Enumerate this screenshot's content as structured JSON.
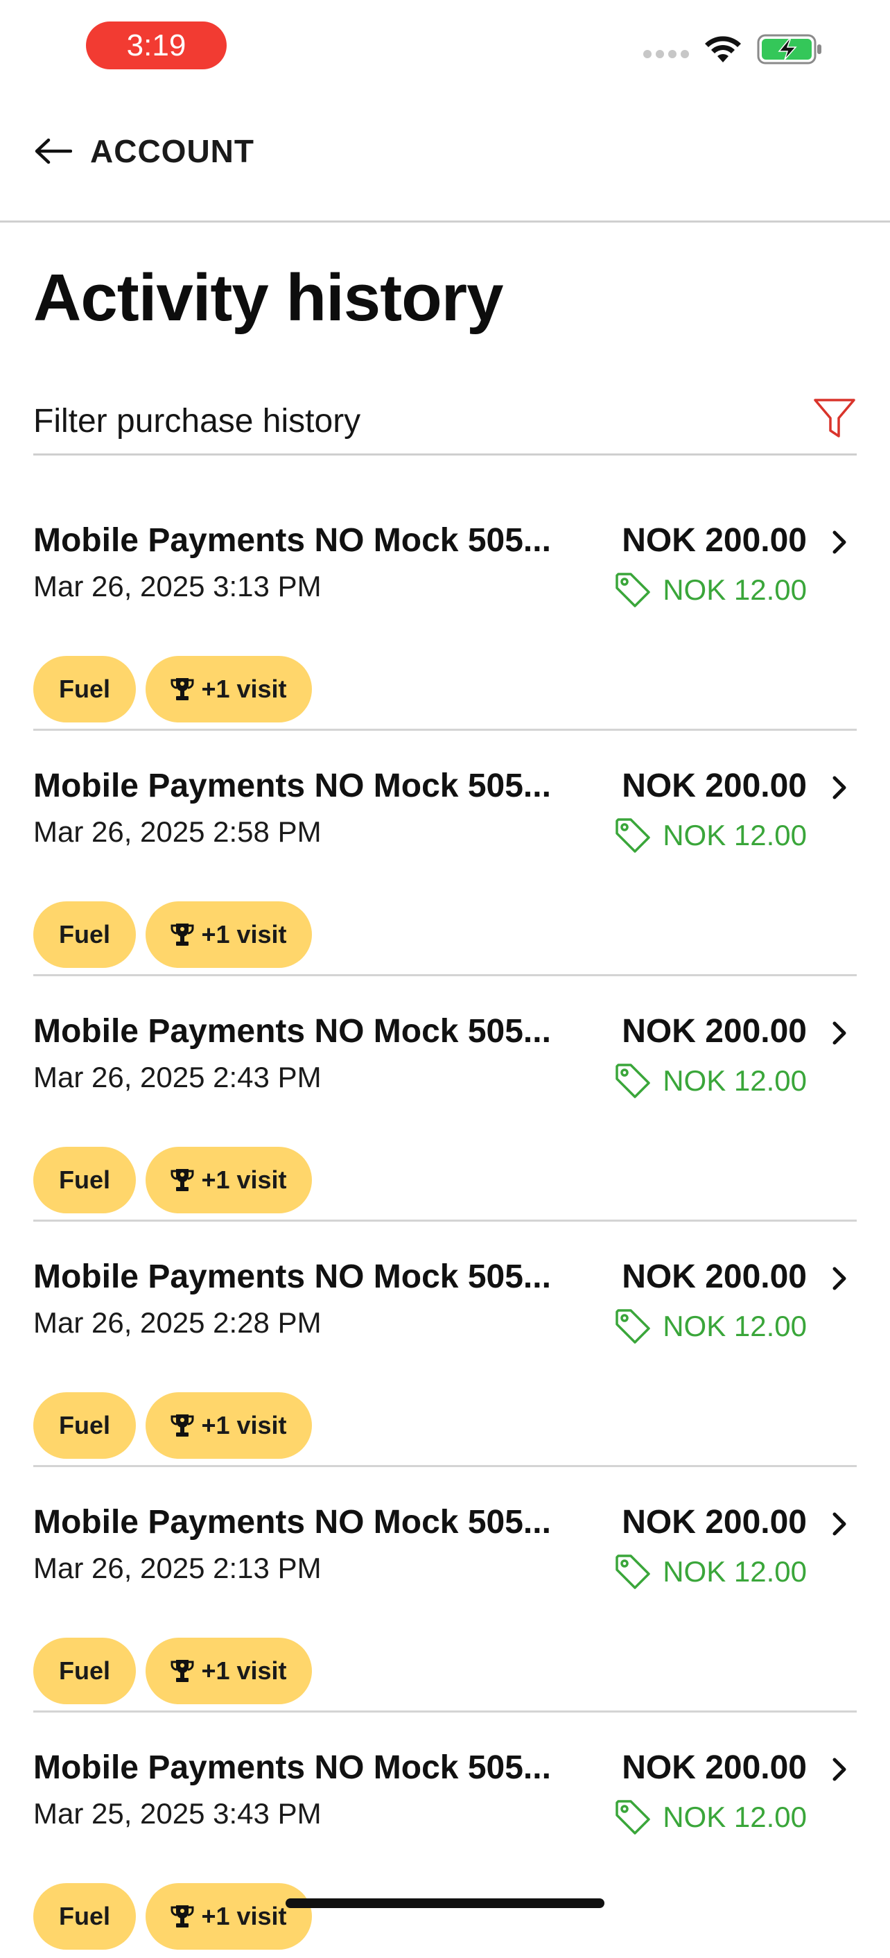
{
  "status_bar": {
    "time": "3:19"
  },
  "nav": {
    "back_label": "ACCOUNT"
  },
  "page": {
    "title": "Activity history"
  },
  "filter": {
    "label": "Filter purchase history"
  },
  "activities": [
    {
      "merchant": "Mobile Payments NO Mock 505...",
      "date": "Mar 26, 2025 3:13 PM",
      "amount": "NOK 200.00",
      "discount": "NOK 12.00",
      "badge_fuel": "Fuel",
      "badge_visit": "+1 visit"
    },
    {
      "merchant": "Mobile Payments NO Mock 505...",
      "date": "Mar 26, 2025 2:58 PM",
      "amount": "NOK 200.00",
      "discount": "NOK 12.00",
      "badge_fuel": "Fuel",
      "badge_visit": "+1 visit"
    },
    {
      "merchant": "Mobile Payments NO Mock 505...",
      "date": "Mar 26, 2025 2:43 PM",
      "amount": "NOK 200.00",
      "discount": "NOK 12.00",
      "badge_fuel": "Fuel",
      "badge_visit": "+1 visit"
    },
    {
      "merchant": "Mobile Payments NO Mock 505...",
      "date": "Mar 26, 2025 2:28 PM",
      "amount": "NOK 200.00",
      "discount": "NOK 12.00",
      "badge_fuel": "Fuel",
      "badge_visit": "+1 visit"
    },
    {
      "merchant": "Mobile Payments NO Mock 505...",
      "date": "Mar 26, 2025 2:13 PM",
      "amount": "NOK 200.00",
      "discount": "NOK 12.00",
      "badge_fuel": "Fuel",
      "badge_visit": "+1 visit"
    },
    {
      "merchant": "Mobile Payments NO Mock 505...",
      "date": "Mar 25, 2025 3:43 PM",
      "amount": "NOK 200.00",
      "discount": "NOK 12.00",
      "badge_fuel": "Fuel",
      "badge_visit": "+1 visit"
    }
  ],
  "colors": {
    "time_pill": "#f23b32",
    "badge": "#ffd66b",
    "discount_green": "#3aa63a",
    "filter_icon_red": "#d9342b",
    "battery_green": "#34c759"
  },
  "icons": {
    "back": "arrow-left-icon",
    "filter": "funnel-icon",
    "tag": "price-tag-icon",
    "trophy": "trophy-icon",
    "chevron": "chevron-right-icon",
    "wifi": "wifi-icon",
    "battery": "battery-charging-icon",
    "signal": "cellular-signal-icon"
  }
}
